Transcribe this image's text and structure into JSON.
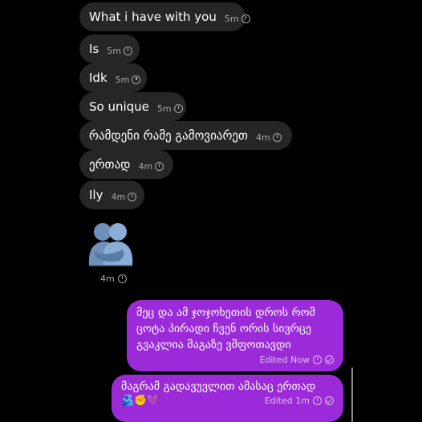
{
  "incoming": [
    {
      "text": "What i have with you",
      "time": "5m"
    },
    {
      "text": "Is",
      "time": "5m"
    },
    {
      "text": "Idk",
      "time": "5m"
    },
    {
      "text": "So unique",
      "time": "5m"
    },
    {
      "text": "რამდენი რამე გამოვიარეთ",
      "time": "4m"
    },
    {
      "text": "ერთად",
      "time": "4m"
    },
    {
      "text": "Ily",
      "time": "4m"
    }
  ],
  "sticker": {
    "icon": "people-hugging-icon",
    "time": "4m"
  },
  "outgoing": [
    {
      "text": "მეც და ამ ჯოჯოხეთის დროს რომ\nცოტა პირადი ჩვენ ორის სივრცე\nგვაკლია მაგაზე ვშფოთავდი",
      "status": "Edited Now"
    },
    {
      "text": "მაგრამ გადავუვლით ამასაც ერთად",
      "emoji": "🫂✊💜",
      "status": "Edited 1m"
    }
  ],
  "colors": {
    "incoming_bg": "#262626",
    "outgoing_bg": "#9b2bd8",
    "background": "#000000"
  }
}
